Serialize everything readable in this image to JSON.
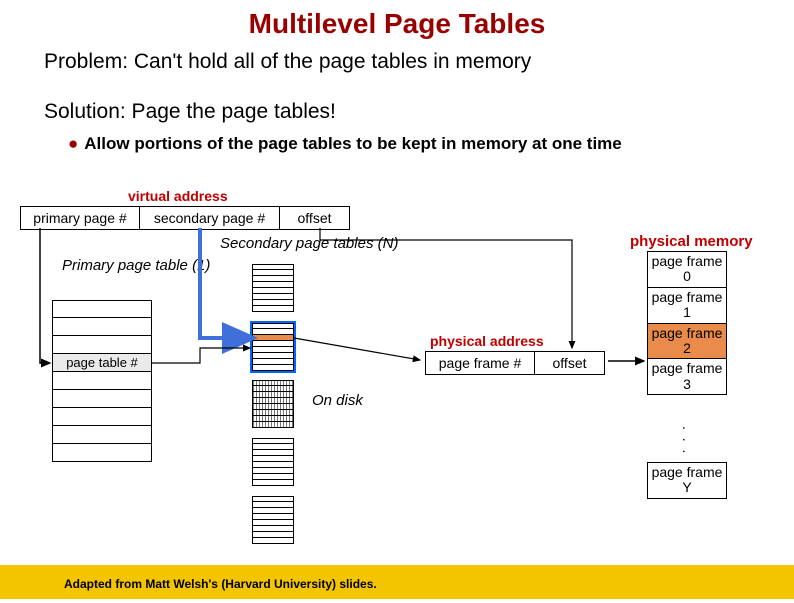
{
  "title": "Multilevel Page Tables",
  "problem": "Problem: Can't hold all of the page tables in memory",
  "solution": "Solution: Page the page tables!",
  "bullet": "Allow portions of the page tables to be kept in memory at one time",
  "va": {
    "label": "virtual address",
    "primary": "primary page #",
    "secondary": "secondary page #",
    "offset": "offset"
  },
  "labels": {
    "primary_table": "Primary page table (1)",
    "secondary_tables": "Secondary page tables (N)",
    "on_disk": "On disk",
    "page_table_num": "page table #"
  },
  "pa": {
    "label": "physical address",
    "pf": "page frame #",
    "offset": "offset"
  },
  "pm": {
    "label": "physical memory",
    "frames": [
      "page frame 0",
      "page frame 1",
      "page frame 2",
      "page frame 3"
    ],
    "ell": ". . .",
    "last": "page frame Y"
  },
  "credit": "Adapted from Matt Welsh's (Harvard University) slides."
}
